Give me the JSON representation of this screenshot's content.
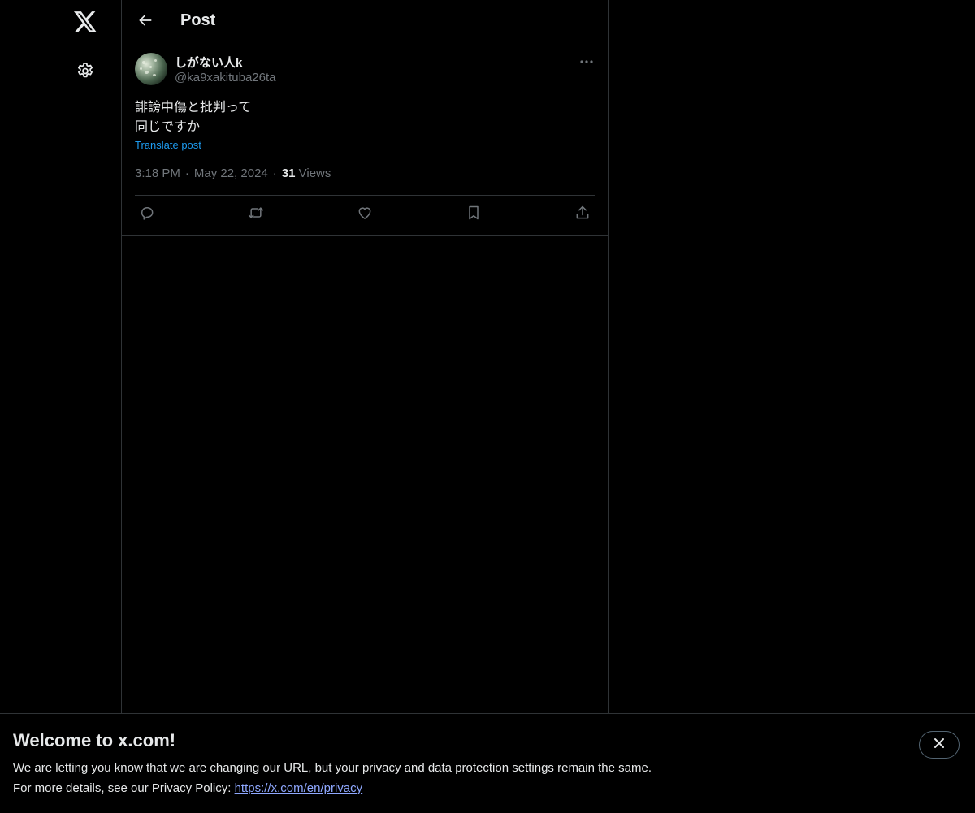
{
  "nav": {
    "logo_icon": "x-logo-icon",
    "settings_icon": "gear-icon"
  },
  "header": {
    "back_icon": "arrow-left-icon",
    "title": "Post"
  },
  "post": {
    "author": {
      "display_name": "しがない人k",
      "handle": "@ka9xakituba26ta"
    },
    "more_icon": "more-horizontal-icon",
    "text_lines": [
      "誹謗中傷と批判って",
      "同じですか"
    ],
    "translate_label": "Translate post",
    "time": "3:18 PM",
    "separator": "·",
    "date": "May 22, 2024",
    "views_count": "31",
    "views_label": "Views",
    "actions": [
      {
        "name": "reply-icon"
      },
      {
        "name": "repost-icon"
      },
      {
        "name": "like-icon"
      },
      {
        "name": "bookmark-icon"
      },
      {
        "name": "share-icon"
      }
    ]
  },
  "banner": {
    "title": "Welcome to x.com!",
    "line1": "We are letting you know that we are changing our URL, but your privacy and data protection settings remain the same.",
    "line2_prefix": "For more details, see our Privacy Policy: ",
    "link_text": "https://x.com/en/privacy",
    "close_icon": "close-icon"
  },
  "colors": {
    "background": "#000000",
    "text_primary": "#e7e9ea",
    "text_secondary": "#71767b",
    "accent": "#1d9bf0",
    "border": "#2f3336"
  }
}
